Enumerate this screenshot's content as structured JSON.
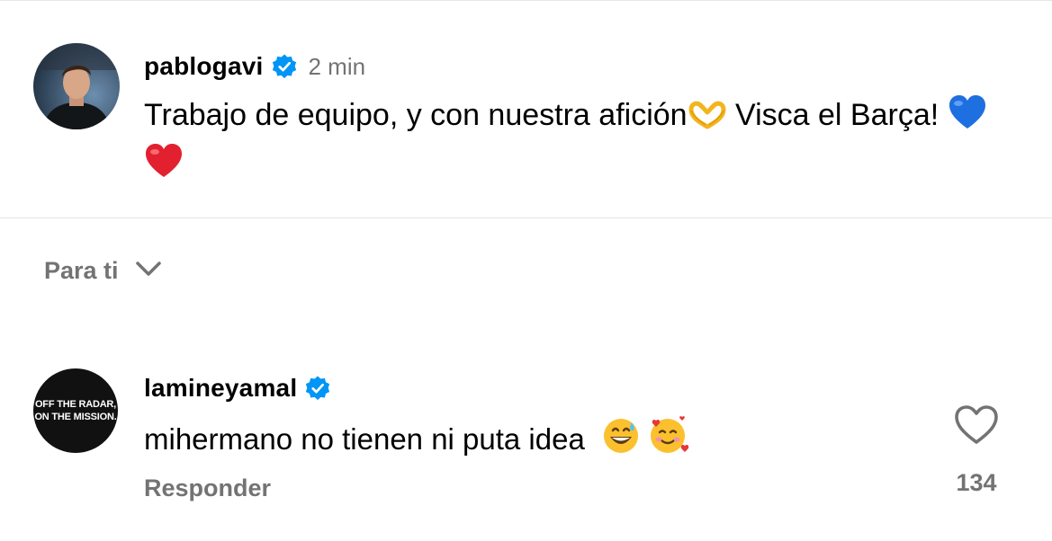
{
  "post": {
    "username": "pablogavi",
    "verified": true,
    "time": "2 min",
    "text_part1": "Trabajo de equipo, y con nuestra afición",
    "emoji1": "heart-hands",
    "text_part2": " Visca el Barça!",
    "emoji2": "blue-heart",
    "emoji3": "red-heart"
  },
  "sort": {
    "label": "Para ti",
    "icon": "chevron-down-icon"
  },
  "comment": {
    "username": "lamineyamal",
    "verified": true,
    "avatar_text_line1": "OFF THE RADAR,",
    "avatar_text_line2": "ON THE MISSION.",
    "text": "mihermano no tienen ni puta idea",
    "emoji1": "grinning-sweat",
    "emoji2": "smiling-hearts",
    "reply_label": "Responder",
    "like_count": "134"
  },
  "colors": {
    "verified_blue": "#0095f6",
    "secondary_text": "#737373",
    "divider": "#e2e4e8"
  }
}
